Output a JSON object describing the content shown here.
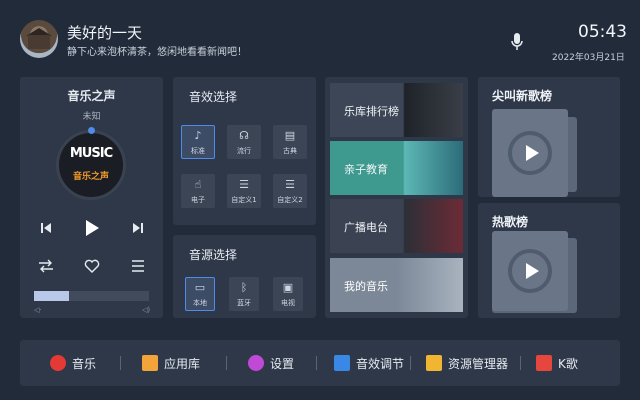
{
  "header": {
    "user_name": "美好的一天",
    "subtitle": "静下心来泡杯清茶，悠闲地看看新闻吧！",
    "time": "05:43",
    "date": "2022年03月21日"
  },
  "player": {
    "title": "音乐之声",
    "artist": "未知",
    "logo_text": "MUSIC",
    "logo_sub": "音乐之声",
    "progress_fraction": 0.3
  },
  "sound_effects": {
    "title": "音效选择",
    "items": [
      {
        "label": "标准",
        "icon": "music-note-icon",
        "active": true
      },
      {
        "label": "流行",
        "icon": "headphones-icon",
        "active": false
      },
      {
        "label": "古典",
        "icon": "piano-icon",
        "active": false
      },
      {
        "label": "电子",
        "icon": "hand-icon",
        "active": false
      },
      {
        "label": "自定义1",
        "icon": "sliders-icon",
        "active": false
      },
      {
        "label": "自定义2",
        "icon": "sliders-icon",
        "active": false
      }
    ]
  },
  "sound_source": {
    "title": "音源选择",
    "items": [
      {
        "label": "本地",
        "icon": "monitor-icon",
        "active": true
      },
      {
        "label": "蓝牙",
        "icon": "bluetooth-icon",
        "active": false
      },
      {
        "label": "电视",
        "icon": "tv-icon",
        "active": false
      }
    ]
  },
  "library": {
    "tiles": [
      "乐库排行榜",
      "亲子教育",
      "广播电台",
      "我的音乐"
    ]
  },
  "charts": {
    "first_title": "尖叫新歌榜",
    "second_title": "热歌榜"
  },
  "dock": {
    "items": [
      "音乐",
      "应用库",
      "设置",
      "音效调节",
      "资源管理器",
      "K歌"
    ]
  },
  "colors": {
    "background": "#222b3a",
    "panel": "#2f3848",
    "accent": "#4f8be8"
  }
}
